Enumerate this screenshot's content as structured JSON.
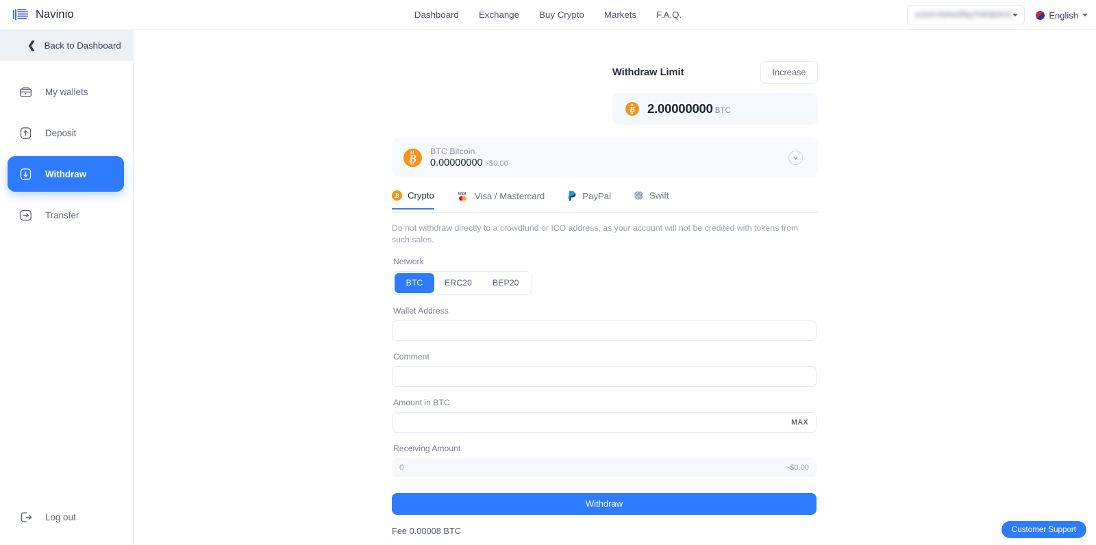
{
  "brand": {
    "name": "Navinio",
    "logo_icon": "navinio-hex-logo"
  },
  "topnav": {
    "items": [
      {
        "label": "Dashboard"
      },
      {
        "label": "Exchange"
      },
      {
        "label": "Buy Crypto"
      },
      {
        "label": "Markets"
      },
      {
        "label": "F.A.Q."
      }
    ]
  },
  "topright": {
    "account": {
      "value": "",
      "icon": "chevron-down-icon"
    },
    "language": {
      "label": "English",
      "flag_icon": "flag-icon",
      "caret_icon": "chevron-down-icon"
    }
  },
  "sidebar": {
    "back": {
      "label": "Back to Dashboard",
      "icon": "chevron-left-icon"
    },
    "items": [
      {
        "label": "My wallets",
        "icon": "wallet-icon",
        "active": false
      },
      {
        "label": "Deposit",
        "icon": "arrow-up-box-icon",
        "active": false
      },
      {
        "label": "Withdraw",
        "icon": "arrow-down-box-icon",
        "active": true
      },
      {
        "label": "Transfer",
        "icon": "arrow-right-box-icon",
        "active": false
      }
    ],
    "logout": {
      "label": "Log out",
      "icon": "logout-icon"
    }
  },
  "withdraw_limit": {
    "title": "Withdraw Limit",
    "increase_label": "Increase",
    "amount": "2.00000000",
    "currency": "BTC",
    "coin_icon": "bitcoin-icon"
  },
  "coin_selector": {
    "symbol_name": "BTC Bitcoin",
    "balance": "0.00000000",
    "usd_value": "~$0.00",
    "coin_icon": "bitcoin-icon",
    "chevron_icon": "chevron-down-circle-icon"
  },
  "method_tabs": [
    {
      "label": "Crypto",
      "icon": "bitcoin-icon",
      "active": true
    },
    {
      "label": "Visa / Mastercard",
      "icon": "visa-mastercard-icon",
      "active": false
    },
    {
      "label": "PayPal",
      "icon": "paypal-icon",
      "active": false
    },
    {
      "label": "Swift",
      "icon": "swift-globe-icon",
      "active": false
    }
  ],
  "notice": "Do not withdraw directly to a crowdfund or ICO address, as your account will not be credited with tokens from such sales.",
  "form": {
    "network_label": "Network",
    "networks": [
      {
        "label": "BTC",
        "active": true
      },
      {
        "label": "ERC20",
        "active": false
      },
      {
        "label": "BEP20",
        "active": false
      }
    ],
    "wallet_address": {
      "label": "Wallet Address",
      "value": "",
      "placeholder": ""
    },
    "comment": {
      "label": "Comment",
      "value": "",
      "placeholder": ""
    },
    "amount": {
      "label": "Amount in BTC",
      "value": "",
      "placeholder": "",
      "max_label": "MAX"
    },
    "receiving": {
      "label": "Receiving Amount",
      "value": "0",
      "usd": "~$0.00"
    },
    "submit_label": "Withdraw",
    "fee": "Fee 0.00008 BTC"
  },
  "support": {
    "label": "Customer Support"
  },
  "colors": {
    "accent": "#2f7bfd",
    "bitcoin_orange": "#f7931a",
    "paypal_blue": "#253b80",
    "text_dark": "#23293a",
    "text_muted": "#8b92a4",
    "panel_bg": "#f7f9fd",
    "sidebar_back_bg": "#edf0f5"
  }
}
